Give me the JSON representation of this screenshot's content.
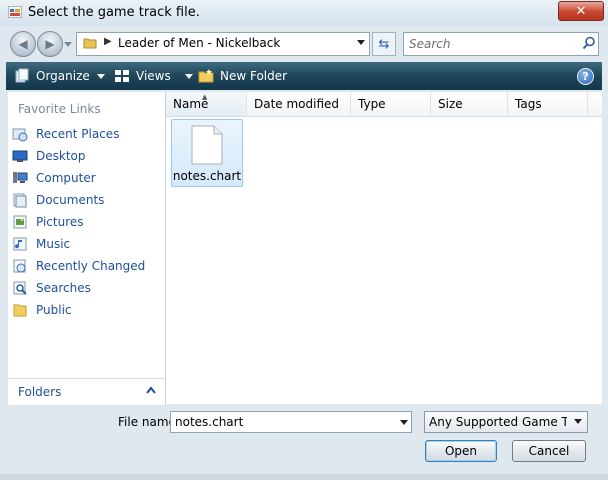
{
  "window": {
    "title": "Select the game track file.",
    "close_label": "✕"
  },
  "navigation": {
    "address": "Leader of Men - Nickelback",
    "search_placeholder": "Search"
  },
  "toolbar": {
    "organize": "Organize",
    "views": "Views",
    "new_folder": "New Folder",
    "help": "?"
  },
  "sidebar": {
    "header": "Favorite Links",
    "items": [
      {
        "label": "Recent Places",
        "icon": "recent-places-icon"
      },
      {
        "label": "Desktop",
        "icon": "desktop-icon"
      },
      {
        "label": "Computer",
        "icon": "computer-icon"
      },
      {
        "label": "Documents",
        "icon": "documents-icon"
      },
      {
        "label": "Pictures",
        "icon": "pictures-icon"
      },
      {
        "label": "Music",
        "icon": "music-icon"
      },
      {
        "label": "Recently Changed",
        "icon": "recently-changed-icon"
      },
      {
        "label": "Searches",
        "icon": "searches-icon"
      },
      {
        "label": "Public",
        "icon": "public-folder-icon"
      }
    ],
    "folders_label": "Folders"
  },
  "file_list": {
    "columns": [
      "Name",
      "Date modified",
      "Type",
      "Size",
      "Tags"
    ],
    "files": [
      {
        "name": "notes.chart",
        "icon": "document-icon",
        "selected": true
      }
    ]
  },
  "footer": {
    "filename_label": "File name:",
    "filename_value": "notes.chart",
    "filetype_value": "Any Supported Game Track F",
    "open_label": "Open",
    "cancel_label": "Cancel"
  },
  "colors": {
    "toolbar": "#1f4658",
    "link": "#1f4f9b",
    "close": "#c9452f"
  }
}
